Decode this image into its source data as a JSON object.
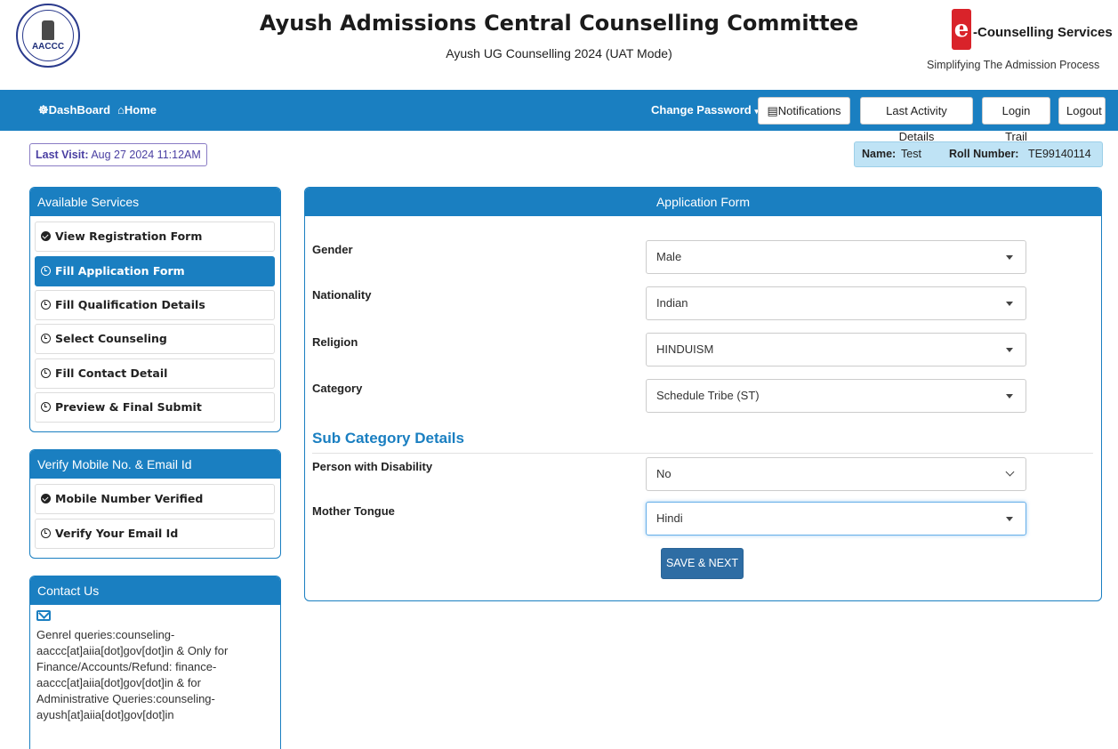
{
  "header": {
    "title": "Ayush Admissions Central Counselling Committee",
    "subtitle": "Ayush UG Counselling 2024 (UAT Mode)",
    "left_logo_text": "AACCC",
    "right_logo_letter": "e",
    "right_logo_text": "-Counselling Services",
    "right_logo_tagline": "Simplifying The Admission Process"
  },
  "navbar": {
    "dashboard": "DashBoard",
    "home": "Home",
    "change_password": "Change Password",
    "notifications": "Notifications",
    "last_activity": "Last Activity Details",
    "login_trail": "Login Trail",
    "logout": "Logout"
  },
  "info": {
    "last_visit_label": "Last Visit:",
    "last_visit_value": "Aug 27 2024 11:12AM",
    "name_label": "Name:",
    "name_value": "Test",
    "roll_label": "Roll Number:",
    "roll_value": "TE99140114"
  },
  "services": {
    "title": "Available Services",
    "items": [
      {
        "label": "View Registration Form",
        "icon": "check-circle-icon"
      },
      {
        "label": "Fill Application Form",
        "icon": "clock-icon"
      },
      {
        "label": "Fill Qualification Details",
        "icon": "clock-icon"
      },
      {
        "label": "Select Counseling",
        "icon": "clock-icon"
      },
      {
        "label": "Fill Contact Detail",
        "icon": "clock-icon"
      },
      {
        "label": "Preview & Final Submit",
        "icon": "clock-icon"
      }
    ]
  },
  "verify": {
    "title": "Verify Mobile No. & Email Id",
    "items": [
      {
        "label": "Mobile Number Verified",
        "icon": "check-circle-icon"
      },
      {
        "label": "Verify Your Email Id",
        "icon": "clock-icon"
      }
    ]
  },
  "contact": {
    "title": "Contact Us",
    "text": "Genrel queries:counseling-aaccc[at]aiia[dot]gov[dot]in & Only for Finance/Accounts/Refund: finance-aaccc[at]aiia[dot]gov[dot]in & for Administrative Queries:counseling-ayush[at]aiia[dot]gov[dot]in"
  },
  "form": {
    "title": "Application Form",
    "fields": [
      {
        "label": "Gender",
        "value": "Male"
      },
      {
        "label": "Nationality",
        "value": "Indian"
      },
      {
        "label": "Religion",
        "value": "HINDUISM"
      },
      {
        "label": "Category",
        "value": "Schedule Tribe (ST)"
      }
    ],
    "subcategory_title": "Sub Category Details",
    "sub_fields": [
      {
        "label": "Person with Disability",
        "value": "No"
      },
      {
        "label": "Mother Tongue",
        "value": "Hindi"
      }
    ],
    "save_button": "SAVE & NEXT"
  },
  "colors": {
    "primary": "#1a7fc1",
    "button": "#2e6da4",
    "info_box": "#bfe3f5"
  }
}
